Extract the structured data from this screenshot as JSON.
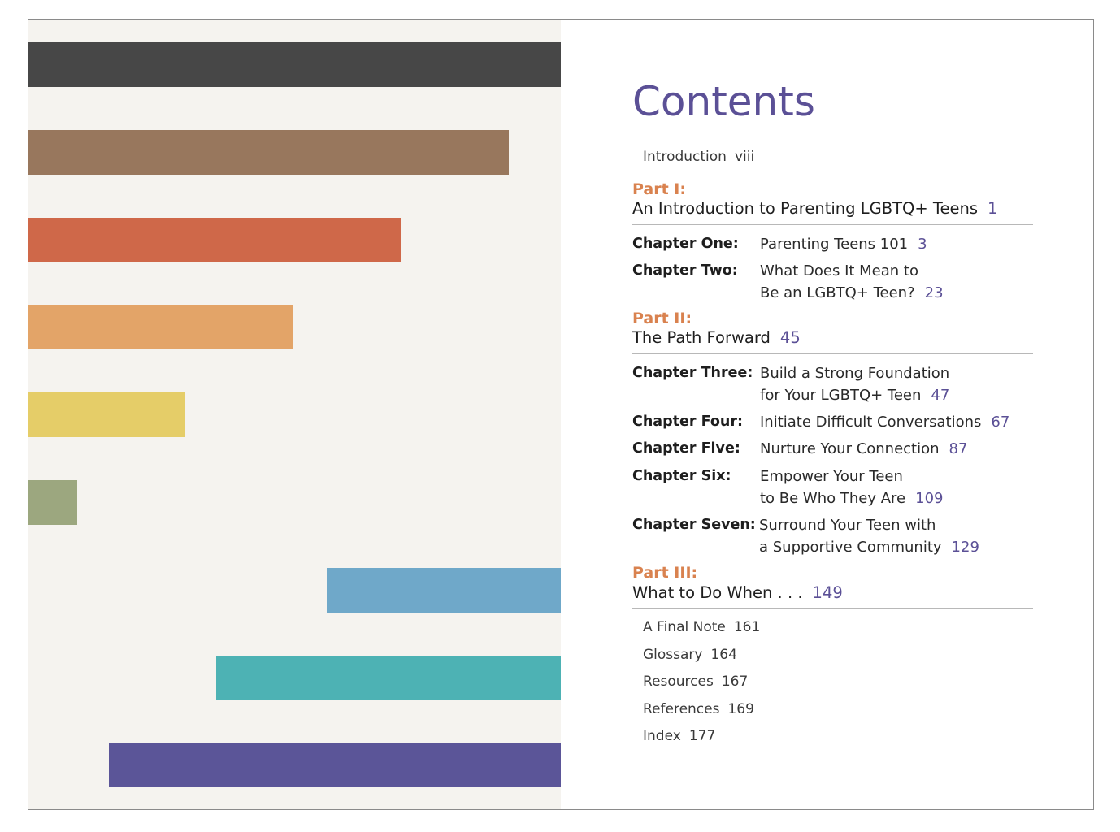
{
  "contents_title": "Contents",
  "front_matter": {
    "label": "Introduction",
    "page": "viii"
  },
  "stripes": [
    {
      "color": "#474747",
      "fraction": 1.0,
      "align": "left"
    },
    {
      "color": "#98775d",
      "fraction": 0.902,
      "align": "left"
    },
    {
      "color": "#cf6849",
      "fraction": 0.7,
      "align": "left"
    },
    {
      "color": "#e3a468",
      "fraction": 0.497,
      "align": "left"
    },
    {
      "color": "#e5cd68",
      "fraction": 0.295,
      "align": "left"
    },
    {
      "color": "#9ca77f",
      "fraction": 0.092,
      "align": "left"
    },
    {
      "color": "#6fa8c9",
      "fraction": 0.44,
      "align": "right"
    },
    {
      "color": "#4db2b4",
      "fraction": 0.647,
      "align": "right"
    },
    {
      "color": "#5b5598",
      "fraction": 0.849,
      "align": "right"
    }
  ],
  "parts": [
    {
      "label": "Part I:",
      "title": "An Introduction to Parenting LGBTQ+ Teens",
      "page": "1",
      "chapters": [
        {
          "label": "Chapter One:",
          "lines": [
            "Parenting Teens 101"
          ],
          "page": "3"
        },
        {
          "label": "Chapter Two:",
          "lines": [
            "What Does It Mean to",
            "Be an LGBTQ+ Teen?"
          ],
          "page": "23"
        }
      ]
    },
    {
      "label": "Part II:",
      "title": "The Path Forward",
      "page": "45",
      "chapters": [
        {
          "label": "Chapter Three:",
          "lines": [
            "Build a Strong Foundation",
            "for Your LGBTQ+ Teen"
          ],
          "page": "47"
        },
        {
          "label": "Chapter Four:",
          "lines": [
            "Initiate Difficult Conversations"
          ],
          "page": "67"
        },
        {
          "label": "Chapter Five:",
          "lines": [
            "Nurture Your Connection"
          ],
          "page": "87"
        },
        {
          "label": "Chapter Six:",
          "lines": [
            "Empower Your Teen",
            "to Be Who They Are"
          ],
          "page": "109"
        },
        {
          "label": "Chapter Seven:",
          "lines": [
            "Surround Your Teen with",
            "a Supportive Community"
          ],
          "page": "129"
        }
      ]
    },
    {
      "label": "Part III:",
      "title": "What to Do When . . .",
      "page": "149",
      "chapters": []
    }
  ],
  "back_matter": [
    {
      "label": "A Final Note",
      "page": "161"
    },
    {
      "label": "Glossary",
      "page": "164"
    },
    {
      "label": "Resources",
      "page": "167"
    },
    {
      "label": "References",
      "page": "169"
    },
    {
      "label": "Index",
      "page": "177"
    }
  ]
}
